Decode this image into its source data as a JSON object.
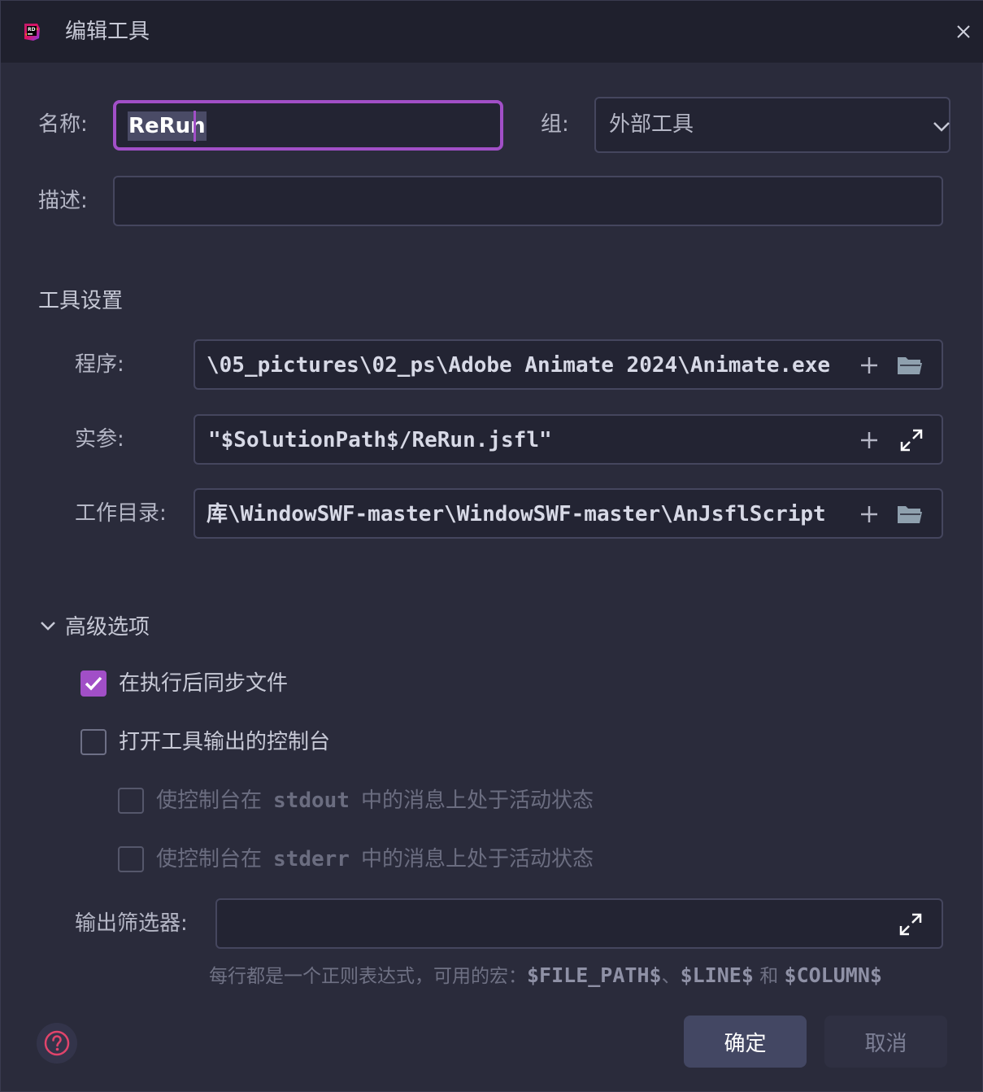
{
  "window": {
    "title": "编辑工具",
    "close_icon": "close-icon"
  },
  "form": {
    "name_label": "名称:",
    "name_value": "ReRun",
    "group_label": "组:",
    "group_value": "外部工具",
    "description_label": "描述:",
    "description_value": ""
  },
  "tool_settings": {
    "section_title": "工具设置",
    "program_label": "程序:",
    "program_value": "\\05_pictures\\02_ps\\Adobe Animate 2024\\Animate.exe",
    "arguments_label": "实参:",
    "arguments_value": "\"$SolutionPath$/ReRun.jsfl\"",
    "working_dir_label": "工作目录:",
    "working_dir_value": "库\\WindowSWF-master\\WindowSWF-master\\AnJsflScript"
  },
  "advanced": {
    "section_title": "高级选项",
    "sync_files_label": "在执行后同步文件",
    "sync_files_checked": true,
    "open_console_label": "打开工具输出的控制台",
    "open_console_checked": false,
    "stdout_prefix": "使控制台在",
    "stdout_code": "stdout",
    "stdout_suffix": "中的消息上处于活动状态",
    "stdout_checked": false,
    "stderr_prefix": "使控制台在",
    "stderr_code": "stderr",
    "stderr_suffix": "中的消息上处于活动状态",
    "stderr_checked": false,
    "output_filters_label": "输出筛选器:",
    "output_filters_value": "",
    "hint_prefix": "每行都是一个正则表达式，可用的宏：",
    "macro_file_path": "$FILE_PATH$",
    "hint_sep": "、",
    "macro_line": "$LINE$",
    "hint_and": "和",
    "macro_column": "$COLUMN$"
  },
  "buttons": {
    "ok": "确定",
    "cancel": "取消"
  },
  "colors": {
    "accent": "#a14fc7",
    "background": "#2a2b3b",
    "titlebar": "#1f202d",
    "help_icon": "#e0446b"
  }
}
